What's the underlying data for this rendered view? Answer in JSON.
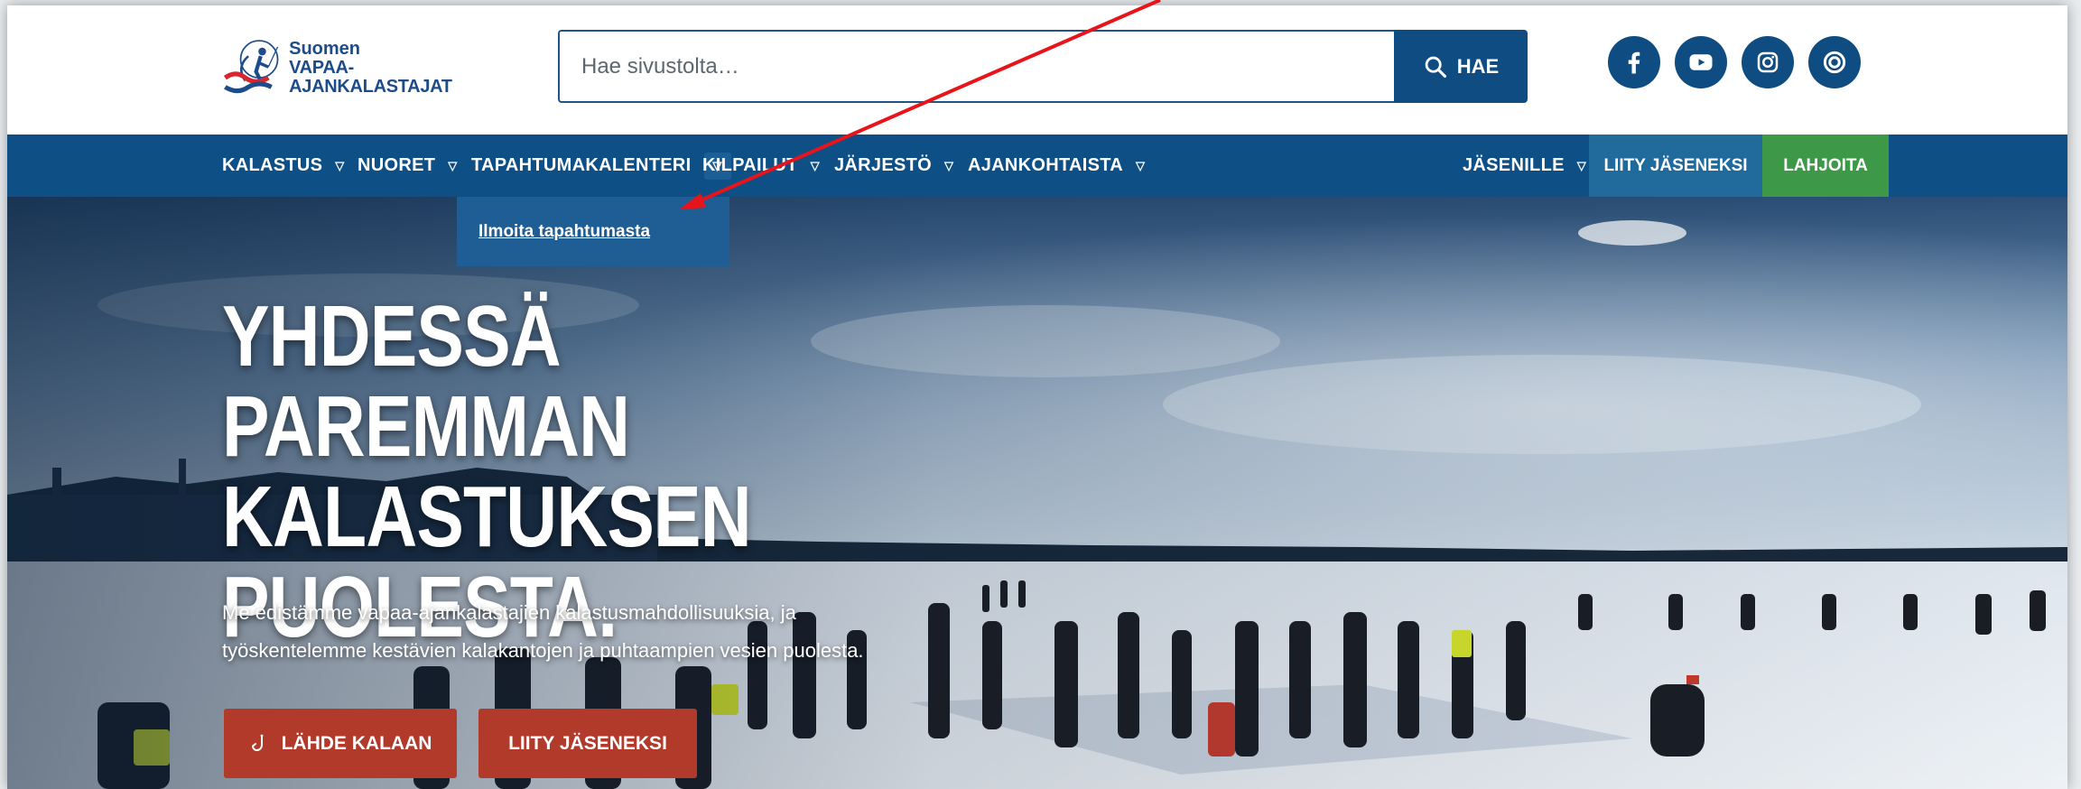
{
  "logo": {
    "line1": "Suomen",
    "line2": "VAPAA-AJANKALASTAJAT"
  },
  "search": {
    "placeholder": "Hae sivustolta…",
    "button_label": "HAE"
  },
  "social": [
    "facebook-icon",
    "youtube-icon",
    "instagram-icon",
    "issuu-icon"
  ],
  "nav": {
    "items": [
      {
        "label": "KALASTUS"
      },
      {
        "label": "NUORET"
      },
      {
        "label": "TAPAHTUMAKALENTERI"
      },
      {
        "label": "KILPAILUT"
      },
      {
        "label": "JÄRJESTÖ"
      },
      {
        "label": "AJANKOHTAISTA"
      }
    ],
    "members": "JÄSENILLE",
    "join": "LIITY JÄSENEKSI",
    "donate": "LAHJOITA",
    "dropdown_item": "Ilmoita tapahtumasta"
  },
  "hero": {
    "title_lines": [
      "YHDESSÄ PAREMMAN",
      "KALASTUKSEN",
      "PUOLESTA."
    ],
    "text_lines": [
      "Me edistämme vapaa-ajankalastajien kalastusmahdollisuuksia, ja",
      "työskentelemme kestävien kalakantojen ja puhtaampien vesien puolesta."
    ],
    "cta_fish": "LÄHDE KALAAN",
    "cta_member": "LIITY JÄSENEKSI"
  },
  "colors": {
    "primary": "#0e4f85",
    "accent_red": "#b13a2a",
    "accent_green": "#3d9947",
    "annotation": "#e8141b"
  }
}
